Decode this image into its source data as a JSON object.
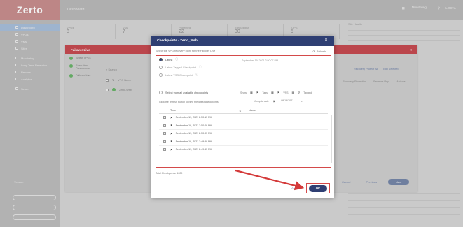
{
  "app": {
    "logo": "Zerto",
    "page_title": "Dashboard"
  },
  "topbar": {
    "search_label": "Monitoring",
    "user_label": "LOCAL"
  },
  "sidebar": {
    "items": [
      {
        "label": "Dashboard"
      },
      {
        "label": "VPGs"
      },
      {
        "label": "VMs"
      },
      {
        "label": "Sites"
      },
      {
        "label": "Monitoring"
      },
      {
        "label": "Long Term Retention"
      },
      {
        "label": "Reports"
      },
      {
        "label": "Analytics"
      },
      {
        "label": "Setup"
      }
    ],
    "meta": "Version"
  },
  "dashboard": {
    "stats": [
      {
        "label": "VPGs",
        "value": "8"
      },
      {
        "label": "VMs",
        "value": "7"
      },
      {
        "label": "Protected",
        "value": "22"
      },
      {
        "label": "Throughput",
        "value": "30"
      },
      {
        "label": "IOPS",
        "value": "5"
      }
    ],
    "right_panel_title": "Site Health"
  },
  "failover_panel": {
    "title": "Failover Live",
    "steps": [
      {
        "label": "Select VPGs"
      },
      {
        "label": "Execution Parameters"
      },
      {
        "label": "Failover Live"
      }
    ],
    "search_label": "Search",
    "rows": [
      {
        "label": "VPG Name"
      },
      {
        "label": "Zerto-Web"
      }
    ],
    "links": [
      "Recovery Protect All",
      "Edit Selected"
    ],
    "columns": [
      "Recovery Protection",
      "Reverse Repl",
      "Actions"
    ],
    "footer": {
      "cancel": "Cancel",
      "previous": "Previous",
      "next": "Next"
    }
  },
  "modal": {
    "title": "Checkpoints - Zerto_Web",
    "description": "Select the VPG recovery point for the Failover Live",
    "refresh_label": "Refresh",
    "options": [
      {
        "label": "Latest",
        "state": "on",
        "detail": "September 19, 2021 2:50:07 PM"
      },
      {
        "label": "Latest Tagged Checkpoint",
        "state": "off",
        "detail": ""
      },
      {
        "label": "Latest VSS Checkpoint",
        "state": "off",
        "detail": ""
      },
      {
        "label": "Select from all available checkpoints",
        "state": "off",
        "detail": ""
      }
    ],
    "filters": [
      "Show",
      "Tags",
      "VSS",
      "Tagged"
    ],
    "hint": "Click the refresh button to view the latest checkpoints",
    "range_label": "Jump to date",
    "range_value": "09/19/2021",
    "table": {
      "col_time": "Time",
      "col_name": "Name",
      "rows": [
        {
          "time": "September 19, 2021 2:50:13 PM"
        },
        {
          "time": "September 19, 2021 2:50:08 PM"
        },
        {
          "time": "September 19, 2021 2:50:03 PM"
        },
        {
          "time": "September 19, 2021 2:49:58 PM"
        },
        {
          "time": "September 19, 2021 2:49:53 PM"
        }
      ]
    },
    "selection_count": "Total Checkpoints: 1029",
    "cancel_label": "Cancel",
    "ok_label": "OK"
  },
  "colors": {
    "modal_header": "#2f3f73",
    "panel_header": "#c6474e",
    "highlight_box": "#d44a4a",
    "step_done": "#66b266"
  }
}
